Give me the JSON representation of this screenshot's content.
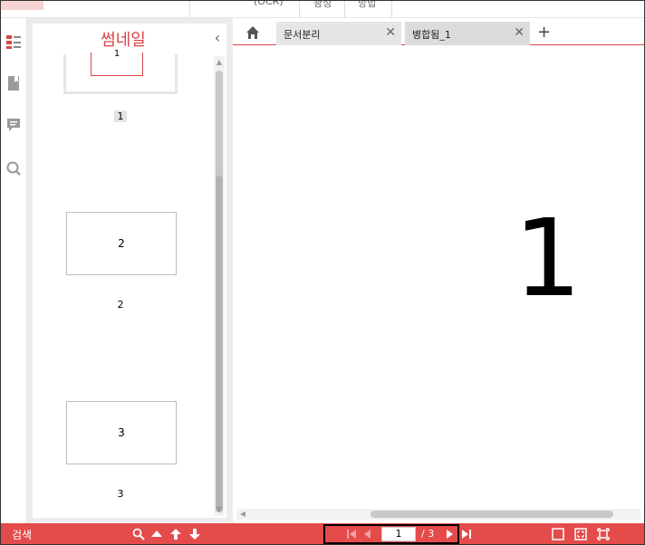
{
  "ribbon": {
    "labels": [
      "(OCR)",
      "광성",
      "방법"
    ]
  },
  "thumbnail_panel": {
    "title": "썸네일",
    "pages": [
      {
        "thumb_text": "1",
        "label": "1"
      },
      {
        "thumb_text": "2",
        "label": "2"
      },
      {
        "thumb_text": "3",
        "label": "3"
      }
    ]
  },
  "tabs": [
    {
      "label": "문서분리"
    },
    {
      "label": "병합됨_1"
    }
  ],
  "document": {
    "page_content": "1"
  },
  "statusbar": {
    "search_label": "검색",
    "current_page": "1",
    "total_pages": "/ 3"
  },
  "colors": {
    "accent": "#e44b4b",
    "title_red": "#d94545"
  }
}
